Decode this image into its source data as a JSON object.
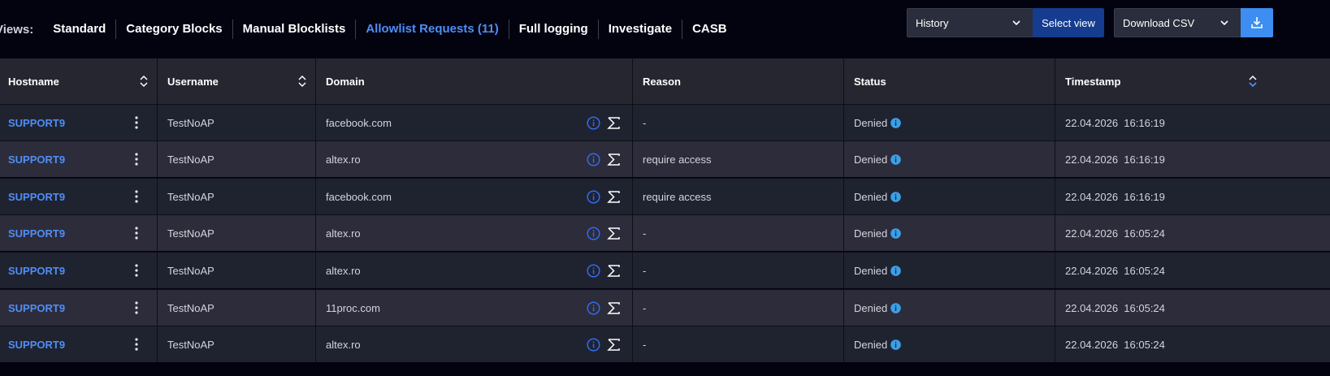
{
  "views": {
    "label": "Views:",
    "tabs": [
      {
        "label": "Standard",
        "active": false
      },
      {
        "label": "Category Blocks",
        "active": false
      },
      {
        "label": "Manual Blocklists",
        "active": false
      },
      {
        "label": "Allowlist Requests (11)",
        "active": true
      },
      {
        "label": "Full logging",
        "active": false
      },
      {
        "label": "Investigate",
        "active": false
      },
      {
        "label": "CASB",
        "active": false
      }
    ]
  },
  "toolbar": {
    "view_select_value": "History",
    "select_view_label": "Select view",
    "export_select_value": "Download CSV"
  },
  "colors": {
    "accent": "#4f8ef7",
    "primary_button": "#153c8f",
    "download_button": "#3d8ef0",
    "info_icon": "#3aa0e8"
  },
  "table": {
    "headers": {
      "hostname": "Hostname",
      "username": "Username",
      "domain": "Domain",
      "reason": "Reason",
      "status": "Status",
      "timestamp": "Timestamp"
    },
    "rows": [
      {
        "hostname": "SUPPORT9",
        "username": "TestNoAP",
        "domain": "facebook.com",
        "reason": "-",
        "status": "Denied",
        "timestamp": "22.04.2026  16:16:19"
      },
      {
        "hostname": "SUPPORT9",
        "username": "TestNoAP",
        "domain": "altex.ro",
        "reason": "require access",
        "status": "Denied",
        "timestamp": "22.04.2026  16:16:19"
      },
      {
        "hostname": "SUPPORT9",
        "username": "TestNoAP",
        "domain": "facebook.com",
        "reason": "require access",
        "status": "Denied",
        "timestamp": "22.04.2026  16:16:19"
      },
      {
        "hostname": "SUPPORT9",
        "username": "TestNoAP",
        "domain": "altex.ro",
        "reason": "-",
        "status": "Denied",
        "timestamp": "22.04.2026  16:05:24"
      },
      {
        "hostname": "SUPPORT9",
        "username": "TestNoAP",
        "domain": "altex.ro",
        "reason": "-",
        "status": "Denied",
        "timestamp": "22.04.2026  16:05:24"
      },
      {
        "hostname": "SUPPORT9",
        "username": "TestNoAP",
        "domain": "11proc.com",
        "reason": "-",
        "status": "Denied",
        "timestamp": "22.04.2026  16:05:24"
      },
      {
        "hostname": "SUPPORT9",
        "username": "TestNoAP",
        "domain": "altex.ro",
        "reason": "-",
        "status": "Denied",
        "timestamp": "22.04.2026  16:05:24"
      }
    ]
  }
}
